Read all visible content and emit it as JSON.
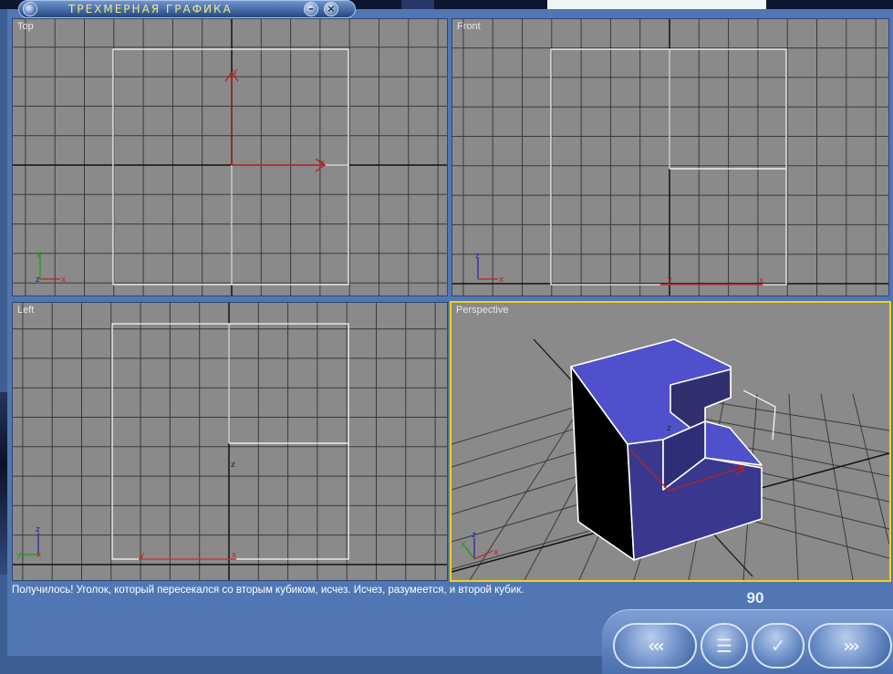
{
  "window": {
    "title": "ТРЕХМЕРНАЯ ГРАФИКА"
  },
  "titlebar": {
    "minimize_icon": "minus-icon",
    "close_icon": "close-icon",
    "logo_icon": "app-logo-icon"
  },
  "viewports": {
    "top": {
      "label": "Top"
    },
    "front": {
      "label": "Front"
    },
    "left": {
      "label": "Left"
    },
    "perspective": {
      "label": "Perspective",
      "active": true
    }
  },
  "axis_letters": {
    "x": "x",
    "y": "y",
    "z": "z"
  },
  "status": {
    "text": "Получилось! Уголок, который пересекался со вторым кубиком, исчез. Исчез, разумеется, и второй кубик."
  },
  "page": {
    "number": "90"
  },
  "nav": {
    "prev_icon": "triple-chevron-left-icon",
    "menu_icon": "menu-lines-icon",
    "ok_icon": "checkmark-icon",
    "next_icon": "triple-chevron-right-icon"
  },
  "colors": {
    "viewport_bg": "#8a8a8a",
    "grid": "#3a3a3a",
    "object_edges": "#ffffff",
    "cube_face": "#5050cc",
    "active_border": "#f0d21c",
    "panel": "#5077b4"
  }
}
